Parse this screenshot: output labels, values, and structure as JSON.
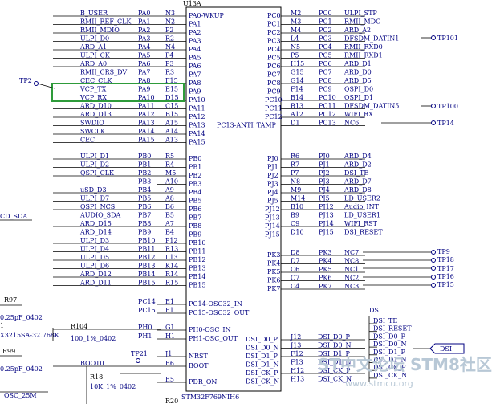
{
  "chip": {
    "ref": "U13A",
    "part": "STM32F769NIH6"
  },
  "left_pins": [
    {
      "net": "B_USER",
      "port": "PA0",
      "ball": "N3",
      "name": "PA0-WKUP"
    },
    {
      "net": "RMII_REF_CLK",
      "port": "PA1",
      "ball": "N2",
      "name": "PA1"
    },
    {
      "net": "RMII_MDIO",
      "port": "PA2",
      "ball": "P2",
      "name": "PA2"
    },
    {
      "net": "ULPI_D0",
      "port": "PA3",
      "ball": "R2",
      "name": "PA3"
    },
    {
      "net": "ARD_A1",
      "port": "PA4",
      "ball": "N4",
      "name": "PA4"
    },
    {
      "net": "ULPI_CK",
      "port": "PA5",
      "ball": "P4",
      "name": "PA5"
    },
    {
      "net": "ARD_A0",
      "port": "PA6",
      "ball": "P3",
      "name": "PA6"
    },
    {
      "net": "RMII_CRS_DV",
      "port": "PA7",
      "ball": "R3",
      "name": "PA7"
    },
    {
      "net": "CEC_CLK",
      "port": "PA8",
      "ball": "F15",
      "name": "PA8"
    },
    {
      "net": "VCP_TX",
      "port": "PA9",
      "ball": "E15",
      "name": "PA9"
    },
    {
      "net": "VCP_RX",
      "port": "PA10",
      "ball": "D15",
      "name": "PA10"
    },
    {
      "net": "ARD_D10",
      "port": "PA11",
      "ball": "C15",
      "name": "PA11"
    },
    {
      "net": "ARD_D13",
      "port": "PA12",
      "ball": "B15",
      "name": "PA12"
    },
    {
      "net": "SWDIO",
      "port": "PA13",
      "ball": "A15",
      "name": "PA13"
    },
    {
      "net": "SWCLK",
      "port": "PA14",
      "ball": "A14",
      "name": "PA14"
    },
    {
      "net": "CEC",
      "port": "PA15",
      "ball": "A13",
      "name": "PA15"
    },
    {
      "net": "ULPI_D1",
      "port": "PB0",
      "ball": "R5",
      "name": "PB0"
    },
    {
      "net": "ULPI_D2",
      "port": "PB1",
      "ball": "R4",
      "name": "PB1"
    },
    {
      "net": "QSPI_CLK",
      "port": "PB2",
      "ball": "M5",
      "name": "PB2"
    },
    {
      "net": "",
      "port": "PB3",
      "ball": "A10",
      "name": "PB3"
    },
    {
      "net": "uSD_D3",
      "port": "PB4",
      "ball": "A9",
      "name": "PB4"
    },
    {
      "net": "ULPI_D7",
      "port": "PB5",
      "ball": "A8",
      "name": "PB5"
    },
    {
      "net": "QSPI_NCS",
      "port": "PB6",
      "ball": "B6",
      "name": "PB6"
    },
    {
      "net": "AUDIO_SDA",
      "port": "PB7",
      "ball": "B5",
      "name": "PB7"
    },
    {
      "net": "ARD_D15",
      "port": "PB8",
      "ball": "A7",
      "name": "PB8"
    },
    {
      "net": "ARD_D14",
      "port": "PB9",
      "ball": "B4",
      "name": "PB9"
    },
    {
      "net": "ULPI_D3",
      "port": "PB10",
      "ball": "P12",
      "name": "PB10"
    },
    {
      "net": "ULPI_D4",
      "port": "PB11",
      "ball": "R13",
      "name": "PB11"
    },
    {
      "net": "ULPI_D5",
      "port": "PB12",
      "ball": "L13",
      "name": "PB12"
    },
    {
      "net": "ULPI_D6",
      "port": "PB13",
      "ball": "K14",
      "name": "PB13"
    },
    {
      "net": "ARD_D12",
      "port": "PB14",
      "ball": "R14",
      "name": "PB14"
    },
    {
      "net": "ARD_D11",
      "port": "PB15",
      "ball": "R15",
      "name": "PB15"
    },
    {
      "net": "",
      "port": "PC14",
      "ball": "E1",
      "name": "PC14-OSC32_IN"
    },
    {
      "net": "",
      "port": "PC15",
      "ball": "F1",
      "name": "PC15-OSC32_OUT"
    },
    {
      "net": "",
      "port": "PH0",
      "ball": "G1",
      "name": "PH0-OSC_IN"
    },
    {
      "net": "",
      "port": "PH1",
      "ball": "H1",
      "name": "PH1-OSC_OUT"
    },
    {
      "net": "",
      "port": "",
      "ball": "J1",
      "name": "NRST"
    },
    {
      "net": "BOOT0",
      "port": "",
      "ball": "E6",
      "name": "BOOT"
    },
    {
      "net": "",
      "port": "",
      "ball": "E5",
      "name": "PDR_ON"
    }
  ],
  "right_pins": [
    {
      "name": "PC0",
      "ball": "M2",
      "port": "PC0",
      "net": "ULPI_STP"
    },
    {
      "name": "PC1",
      "ball": "M3",
      "port": "PC1",
      "net": "RMII_MDC"
    },
    {
      "name": "PC2",
      "ball": "M4",
      "port": "PC2",
      "net": "ARD_A2"
    },
    {
      "name": "PC3",
      "ball": "L4",
      "port": "PC3",
      "net": "DFSDM_DATIN1"
    },
    {
      "name": "PC4",
      "ball": "N5",
      "port": "PC4",
      "net": "RMII_RXD0"
    },
    {
      "name": "PC5",
      "ball": "P5",
      "port": "PC5",
      "net": "RMII_RXD1"
    },
    {
      "name": "PC6",
      "ball": "H15",
      "port": "PC6",
      "net": "ARD_D1"
    },
    {
      "name": "PC7",
      "ball": "G15",
      "port": "PC7",
      "net": "ARD_D0"
    },
    {
      "name": "PC8",
      "ball": "G14",
      "port": "PC8",
      "net": "ARD_D5"
    },
    {
      "name": "PC9",
      "ball": "F14",
      "port": "PC9",
      "net": "QSPI_D0"
    },
    {
      "name": "PC10",
      "ball": "B14",
      "port": "PC10",
      "net": "QSPI_D1"
    },
    {
      "name": "PC11",
      "ball": "B13",
      "port": "PC11",
      "net": "DFSDM_DATIN5"
    },
    {
      "name": "PC12",
      "ball": "A12",
      "port": "PC12",
      "net": "WIFI_RX"
    },
    {
      "name": "PC13-ANTI_TAMP",
      "ball": "D1",
      "port": "PC13",
      "net": "NC6"
    },
    {
      "name": "PJ0",
      "ball": "R6",
      "port": "PJ0",
      "net": "ARD_D4"
    },
    {
      "name": "PJ1",
      "ball": "R7",
      "port": "PJ1",
      "net": "ARD_D2"
    },
    {
      "name": "PJ2",
      "ball": "P7",
      "port": "PJ2",
      "net": "DSI_TE"
    },
    {
      "name": "PJ3",
      "ball": "N8",
      "port": "PJ3",
      "net": "ARD_D7"
    },
    {
      "name": "PJ4",
      "ball": "M9",
      "port": "PJ4",
      "net": "ARD_D8"
    },
    {
      "name": "PJ5",
      "ball": "M14",
      "port": "PJ5",
      "net": "LD_USER2"
    },
    {
      "name": "PJ12",
      "ball": "B10",
      "port": "PJ12",
      "net": "Audio_INT"
    },
    {
      "name": "PJ13",
      "ball": "B9",
      "port": "PJ13",
      "net": "LD_USER1"
    },
    {
      "name": "PJ14",
      "ball": "C9",
      "port": "PJ14",
      "net": "WIFI_RST"
    },
    {
      "name": "PJ15",
      "ball": "D10",
      "port": "PJ15",
      "net": "DSI_RESET"
    },
    {
      "name": "PK3",
      "ball": "D8",
      "port": "PK3",
      "net": "NC7"
    },
    {
      "name": "PK4",
      "ball": "D7",
      "port": "PK4",
      "net": "NC8"
    },
    {
      "name": "PK5",
      "ball": "C6",
      "port": "PK5",
      "net": "NC1"
    },
    {
      "name": "PK6",
      "ball": "C7",
      "port": "PK6",
      "net": "NC2"
    },
    {
      "name": "PK7",
      "ball": "C4",
      "port": "PK7",
      "net": "NC3"
    },
    {
      "name": "DSI_D0_P",
      "ball": "J12",
      "port": "",
      "net": "DSI_D0_P"
    },
    {
      "name": "DSI_D0_N",
      "ball": "J13",
      "port": "",
      "net": "DSI_D0_N"
    },
    {
      "name": "DSI_D1_P",
      "ball": "F12",
      "port": "",
      "net": "DSI_D1_P"
    },
    {
      "name": "DSI_D1_N",
      "ball": "F13",
      "port": "",
      "net": "DSI_D1_N"
    },
    {
      "name": "DSI_CK_P",
      "ball": "H12",
      "port": "",
      "net": "DSI_CK_P"
    },
    {
      "name": "DSI_CK_N",
      "ball": "H13",
      "port": "",
      "net": "DSI_CK_N"
    }
  ],
  "test_points": [
    "TP101",
    "TP100",
    "TP14",
    "TP2",
    "TP9",
    "TP18",
    "TP17",
    "TP16",
    "TP15",
    "TP21"
  ],
  "left_extras": {
    "cd_sda": "CD_SDA",
    "r97": "R97",
    "c_top": "0.25pF_0402",
    "xtal": "X3215SA-32.768K",
    "r104": "R104",
    "r104_val": "100_1%_0402",
    "r99": "R99",
    "c_bot": "0.25pF_0402",
    "r18": "R18",
    "r18_val": "10K_1%_0402",
    "osc": "OSC_25M",
    "r20": "R20",
    "one": "1"
  },
  "dsi_bus": {
    "title": "DSI",
    "signals": [
      "DSI_TE",
      "DSI_RESET",
      "DSI_D0_P",
      "DSI_D0_N",
      "DSI_D1_P",
      "DSI_D1_N",
      "DSI_CK_P",
      "DSI_CK_N"
    ],
    "port_label": "DSI"
  },
  "watermark": {
    "line1": "ST中文论坛 STM8社区",
    "line2": "www.stmcu.org"
  },
  "colors": {
    "net_text": "#000080",
    "wire": "#000000",
    "highlight": "#2e9b3a"
  }
}
